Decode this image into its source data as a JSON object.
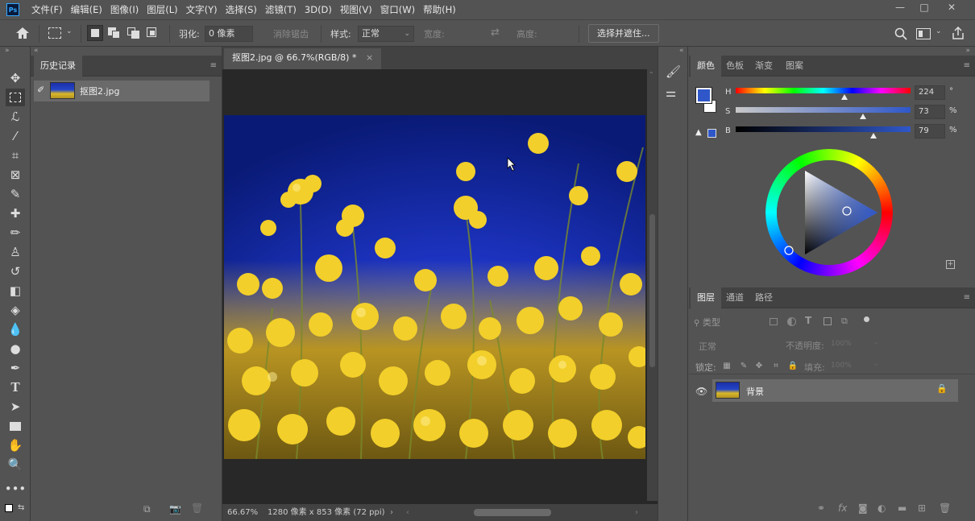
{
  "menu": {
    "logo": "Ps",
    "items": [
      "文件(F)",
      "编辑(E)",
      "图像(I)",
      "图层(L)",
      "文字(Y)",
      "选择(S)",
      "滤镜(T)",
      "3D(D)",
      "视图(V)",
      "窗口(W)",
      "帮助(H)"
    ]
  },
  "window_controls": {
    "minimize": "—",
    "maximize": "□",
    "close": "✕"
  },
  "options": {
    "feather_label": "羽化:",
    "feather_value": "0 像素",
    "antialias_label": "消除锯齿",
    "style_label": "样式:",
    "style_value": "正常",
    "width_label": "宽度:",
    "height_label": "高度:",
    "select_mask_button": "选择并遮住..."
  },
  "history": {
    "tab_label": "历史记录",
    "snapshot_name": "抠图2.jpg"
  },
  "document": {
    "tab_title": "抠图2.jpg @ 66.7%(RGB/8) *",
    "tab_close": "×",
    "zoom": "66.67%",
    "info": "1280 像素 x 853 像素 (72 ppi)",
    "info_arrow": "›"
  },
  "color_panel": {
    "tabs": [
      "颜色",
      "色板",
      "渐变",
      "图案"
    ],
    "h_label": "H",
    "h_value": "224",
    "h_unit": "°",
    "s_label": "S",
    "s_value": "73",
    "s_unit": "%",
    "b_label": "B",
    "b_value": "79",
    "b_unit": "%",
    "foreground": "#2f57c9",
    "background": "#ffffff"
  },
  "layers_panel": {
    "tabs": [
      "图层",
      "通道",
      "路径"
    ],
    "filter_label": "类型",
    "blend_mode": "正常",
    "opacity_label": "不透明度:",
    "opacity_value": "100%",
    "lock_label": "锁定:",
    "fill_label": "填充:",
    "fill_value": "100%",
    "layer_name": "背景"
  },
  "icons": {
    "accent": "#31a8ff"
  }
}
